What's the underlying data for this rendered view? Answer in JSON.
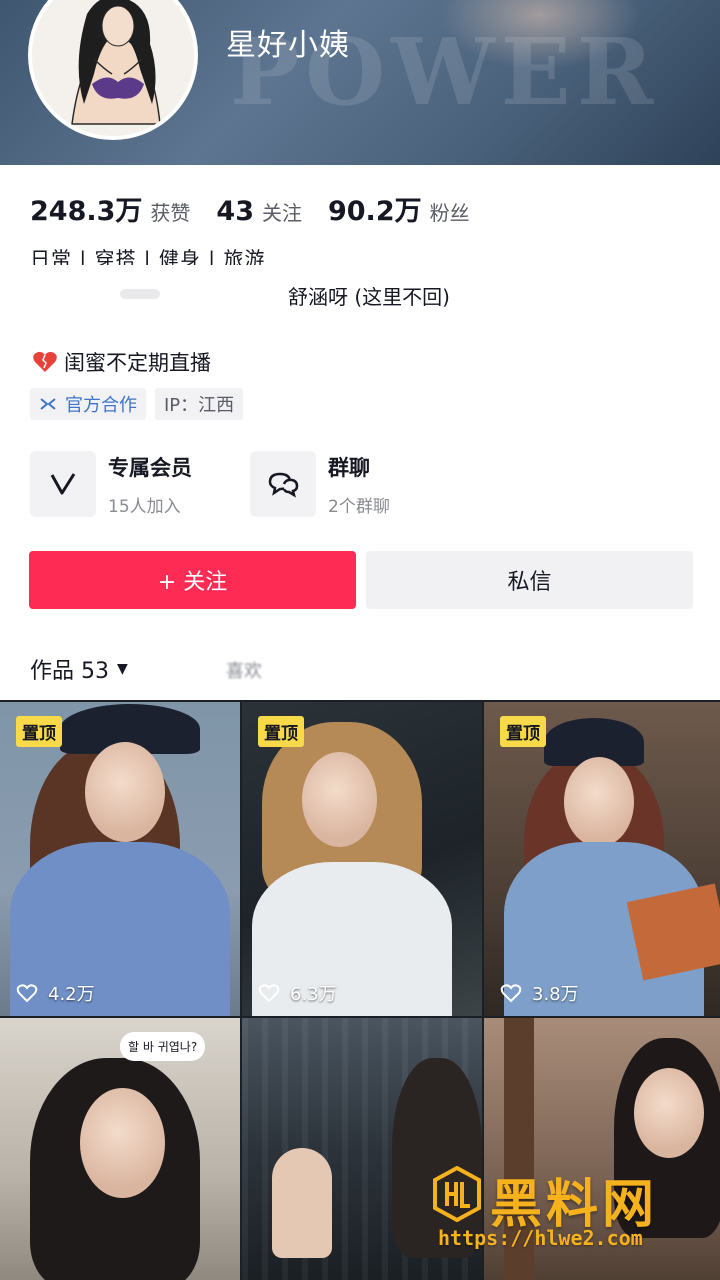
{
  "profile": {
    "nickname": "星好小姨",
    "stats": [
      {
        "value": "248.3万",
        "label": "获赞"
      },
      {
        "value": "43",
        "label": "关注"
      },
      {
        "value": "90.2万",
        "label": "粉丝"
      }
    ],
    "tags_line": "日常 | 穿搭 | 健身 | 旅游",
    "bio_line": "舒涵呀 (这里不回)",
    "live_line": "闺蜜不定期直播",
    "chips": {
      "official": "官方合作",
      "ip": "IP：江西"
    }
  },
  "features": [
    {
      "title": "专属会员",
      "subtitle": "15人加入",
      "icon": "membership-v-icon"
    },
    {
      "title": "群聊",
      "subtitle": "2个群聊",
      "icon": "chat-bubbles-icon"
    }
  ],
  "actions": {
    "follow": "+ 关注",
    "message": "私信"
  },
  "tabs": {
    "works": "作品 53",
    "works_caret": "▼",
    "other": "喜欢"
  },
  "videos": [
    {
      "pinned": true,
      "pin_label": "置顶",
      "likes": "4.2万"
    },
    {
      "pinned": true,
      "pin_label": "置顶",
      "likes": "6.3万"
    },
    {
      "pinned": true,
      "pin_label": "置顶",
      "likes": "3.8万"
    },
    {
      "pinned": false,
      "sticker": "할 바 귀엽나?"
    },
    {
      "pinned": false
    },
    {
      "pinned": false
    }
  ],
  "site_watermark": {
    "brand": "黑料网",
    "url": "https://hlwe2.com"
  },
  "colors": {
    "accent_follow": "#fe2c55",
    "pin_badge": "#f8d94a",
    "official_blue": "#3f74c8",
    "watermark_gold": "#f6b21c"
  }
}
